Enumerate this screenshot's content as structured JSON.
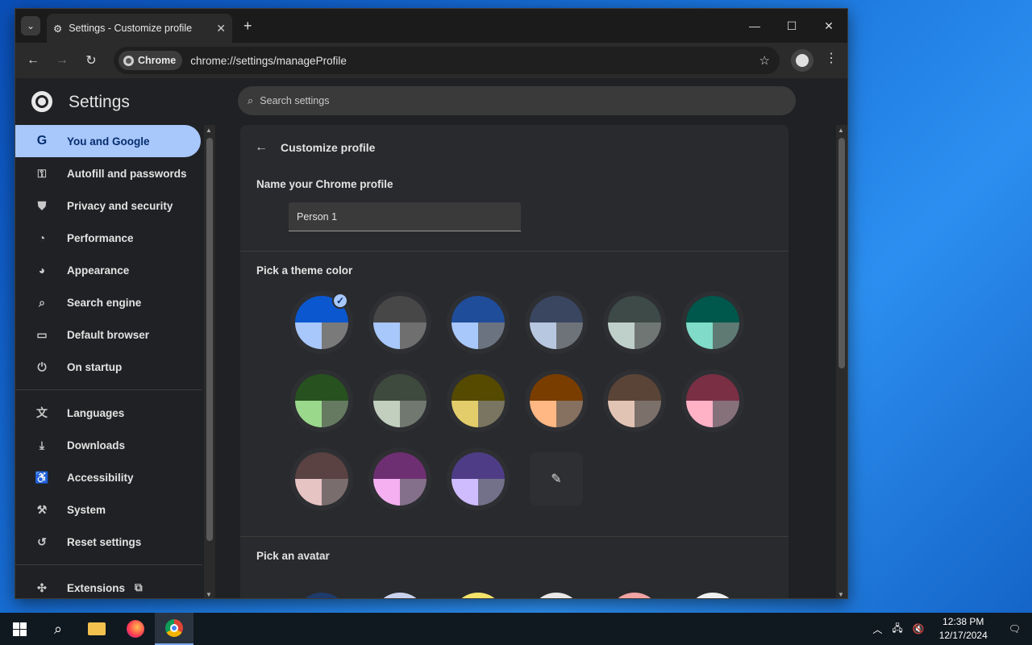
{
  "browser": {
    "tab_title": "Settings - Customize profile",
    "new_tab": "+",
    "chip_label": "Chrome",
    "url": "chrome://settings/manageProfile"
  },
  "settings": {
    "title": "Settings",
    "search_placeholder": "Search settings"
  },
  "sidebar": {
    "items": [
      {
        "label": "You and Google",
        "icon": "google-icon",
        "glyph": "G",
        "active": true
      },
      {
        "label": "Autofill and passwords",
        "icon": "key-icon",
        "glyph": "⚿"
      },
      {
        "label": "Privacy and security",
        "icon": "shield-icon",
        "glyph": "⛊"
      },
      {
        "label": "Performance",
        "icon": "speedometer-icon",
        "glyph": "◔"
      },
      {
        "label": "Appearance",
        "icon": "palette-icon",
        "glyph": "◕"
      },
      {
        "label": "Search engine",
        "icon": "search-icon",
        "glyph": "⌕"
      },
      {
        "label": "Default browser",
        "icon": "browser-window-icon",
        "glyph": "▭"
      },
      {
        "label": "On startup",
        "icon": "power-icon",
        "glyph": "⏻"
      },
      {
        "label": "Languages",
        "icon": "translate-icon",
        "glyph": "文"
      },
      {
        "label": "Downloads",
        "icon": "download-icon",
        "glyph": "⤓"
      },
      {
        "label": "Accessibility",
        "icon": "accessibility-icon",
        "glyph": "♿"
      },
      {
        "label": "System",
        "icon": "wrench-icon",
        "glyph": "⚒"
      },
      {
        "label": "Reset settings",
        "icon": "reset-icon",
        "glyph": "↺"
      },
      {
        "label": "Extensions",
        "icon": "puzzle-icon",
        "glyph": "✣",
        "ext": "⧉"
      }
    ]
  },
  "main": {
    "heading": "Customize profile",
    "name_label": "Name your Chrome profile",
    "name_value": "Person 1",
    "theme_label": "Pick a theme color",
    "avatar_label": "Pick an avatar",
    "themes": [
      {
        "top": "#0b57d0",
        "bl": "#a8c7fa",
        "br": "#7a7a7a",
        "selected": true
      },
      {
        "top": "#474747",
        "bl": "#a8c7fa",
        "br": "#6f6f6f"
      },
      {
        "top": "#1f4d9a",
        "bl": "#a8c7fa",
        "br": "#6b7280"
      },
      {
        "top": "#3a4660",
        "bl": "#b8c7e0",
        "br": "#6e737a"
      },
      {
        "top": "#3d4a47",
        "bl": "#bfcfca",
        "br": "#6f7674"
      },
      {
        "top": "#00574b",
        "bl": "#80dcc8",
        "br": "#5e7a73"
      },
      {
        "top": "#27521f",
        "bl": "#9ad88c",
        "br": "#667a62"
      },
      {
        "top": "#3e4a3d",
        "bl": "#c2cfbf",
        "br": "#707870"
      },
      {
        "top": "#554a00",
        "bl": "#e3cd6b",
        "br": "#7a7560"
      },
      {
        "top": "#7a3d00",
        "bl": "#ffb784",
        "br": "#86705f"
      },
      {
        "top": "#5a4438",
        "bl": "#e2c4b5",
        "br": "#7c706a"
      },
      {
        "top": "#7a2f45",
        "bl": "#ffb1c6",
        "br": "#86707a"
      },
      {
        "top": "#5a4242",
        "bl": "#e6c4c4",
        "br": "#7a6d6d"
      },
      {
        "top": "#6e2f72",
        "bl": "#f4b0f0",
        "br": "#84708a"
      },
      {
        "top": "#4e3d86",
        "bl": "#cfbcff",
        "br": "#73708a"
      }
    ],
    "avatar_colors": [
      "#1f3b6b",
      "#c9d3ee",
      "#f4e36b",
      "#e8e8e8",
      "#f2a3a3",
      "#f0f0f0"
    ]
  },
  "taskbar": {
    "time": "12:38 PM",
    "date": "12/17/2024"
  }
}
